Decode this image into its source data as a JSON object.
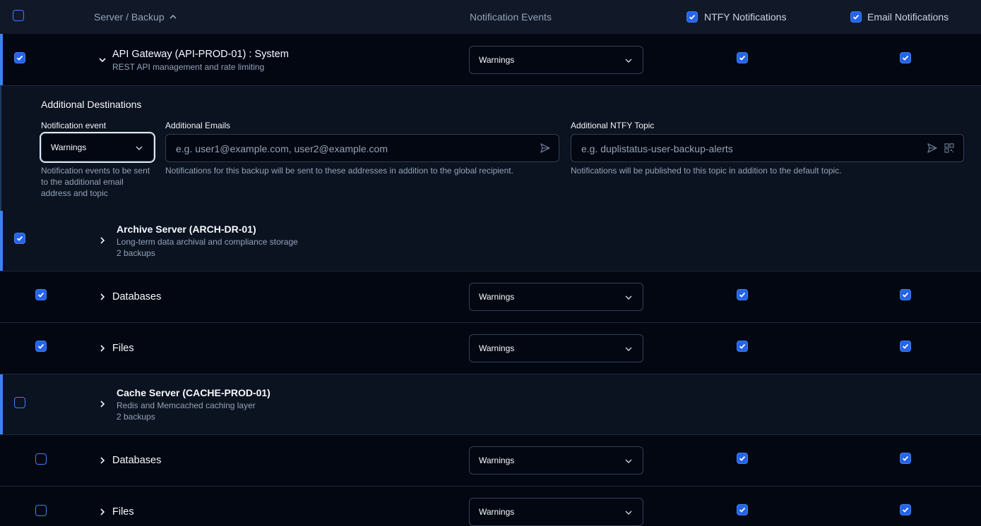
{
  "header": {
    "col_server": "Server / Backup",
    "col_events": "Notification Events",
    "col_ntfy": "NTFY Notifications",
    "col_email": "Email Notifications"
  },
  "api_gateway": {
    "title": "API Gateway (API-PROD-01) : System",
    "description": "REST API management and rate limiting",
    "event": "Warnings"
  },
  "details": {
    "heading": "Additional Destinations",
    "event_label": "Notification event",
    "event_value": "Warnings",
    "event_help": "Notification events to be sent to the additional email address and topic",
    "emails_label": "Additional Emails",
    "emails_placeholder": "e.g. user1@example.com, user2@example.com",
    "emails_help": "Notifications for this backup will be sent to these addresses in addition to the global recipient.",
    "ntfy_label": "Additional NTFY Topic",
    "ntfy_placeholder": "e.g. duplistatus-user-backup-alerts",
    "ntfy_help": "Notifications will be published to this topic in addition to the default topic."
  },
  "archive_server": {
    "name": "Archive Server (ARCH-DR-01)",
    "description": "Long-term data archival and compliance storage",
    "count": "2 backups",
    "backups": [
      {
        "name": "Databases",
        "event": "Warnings"
      },
      {
        "name": "Files",
        "event": "Warnings"
      }
    ]
  },
  "cache_server": {
    "name": "Cache Server (CACHE-PROD-01)",
    "description": "Redis and Memcached caching layer",
    "count": "2 backups",
    "backups": [
      {
        "name": "Databases",
        "event": "Warnings"
      },
      {
        "name": "Files",
        "event": "Warnings"
      }
    ]
  },
  "icons": {
    "sort": "chevron-up-icon",
    "expand": "chevron-right-icon",
    "collapse": "chevron-down-icon",
    "dropdown": "chevron-down-icon",
    "send": "send-icon",
    "qr": "qr-code-icon",
    "check": "check-icon"
  },
  "colors": {
    "background": "#030712",
    "header": "#111827",
    "server_row": "#0b1220",
    "accent": "#3b82f6",
    "checkbox": "#2563eb"
  }
}
